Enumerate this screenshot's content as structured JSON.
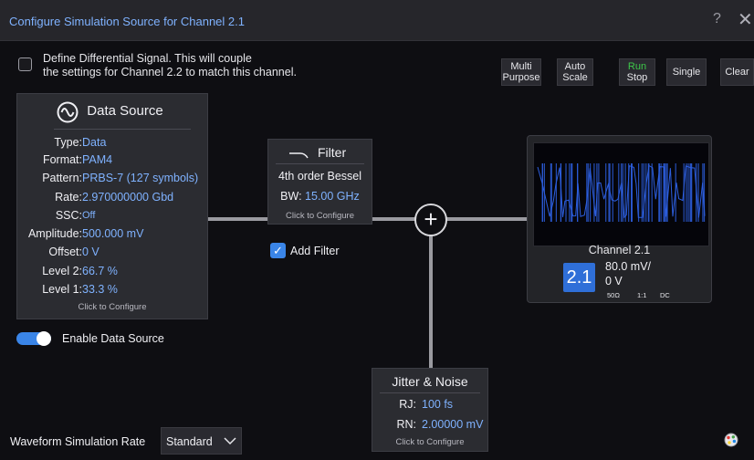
{
  "window": {
    "title": "Configure Simulation Source for Channel 2.1",
    "help_label": "?",
    "close_label": "✕"
  },
  "differential": {
    "label_line1": "Define Differential Signal.  This will couple",
    "label_line2": "the settings for Channel 2.2 to match this channel.",
    "checked": false
  },
  "toolbar": {
    "multi_purpose_l1": "Multi",
    "multi_purpose_l2": "Purpose",
    "auto_scale_l1": "Auto",
    "auto_scale_l2": "Scale",
    "run_l1": "Run",
    "run_l2": "Stop",
    "single": "Single",
    "clear": "Clear"
  },
  "data_source": {
    "title": "Data Source",
    "fields": [
      {
        "label": "Type:",
        "value": "Data"
      },
      {
        "label": "Format:",
        "value": "PAM4"
      },
      {
        "label": "Pattern:",
        "value": "PRBS-7 (127 symbols)"
      },
      {
        "label": "Rate:",
        "value": "2.970000000 Gbd"
      },
      {
        "label": "SSC:",
        "value": "Off"
      },
      {
        "label": "Amplitude:",
        "value": "500.000 mV"
      },
      {
        "label": "Offset:",
        "value": "0 V"
      },
      {
        "label": "Level 2:",
        "value": "66.7 %"
      },
      {
        "label": "Level 1:",
        "value": "33.3 %"
      }
    ],
    "click_hint": "Click to Configure"
  },
  "enable_source": {
    "label": "Enable Data Source",
    "enabled": true
  },
  "filter": {
    "title": "Filter",
    "type": "4th order Bessel",
    "bw_label": "BW:",
    "bw_value": "15.00 GHz",
    "click_hint": "Click to Configure",
    "add_label": "Add Filter",
    "add_checked": true
  },
  "jitter": {
    "title": "Jitter & Noise",
    "rj_label": "RJ:",
    "rj_value": "100 fs",
    "rn_label": "RN:",
    "rn_value": "2.00000 mV",
    "click_hint": "Click to Configure"
  },
  "channel": {
    "name": "Channel 2.1",
    "badge": "2.1",
    "scale": "80.0 mV/",
    "offset": "0 V",
    "impedance": "50Ω",
    "ratio": "1:1",
    "coupling": "DC",
    "waveform_color": "#2d5fe0"
  },
  "footer": {
    "rate_label": "Waveform Simulation Rate",
    "rate_value": "Standard"
  },
  "colors": {
    "accent": "#3a85e8",
    "value_text": "#7fb2ff",
    "run_green": "#3ec84a"
  }
}
